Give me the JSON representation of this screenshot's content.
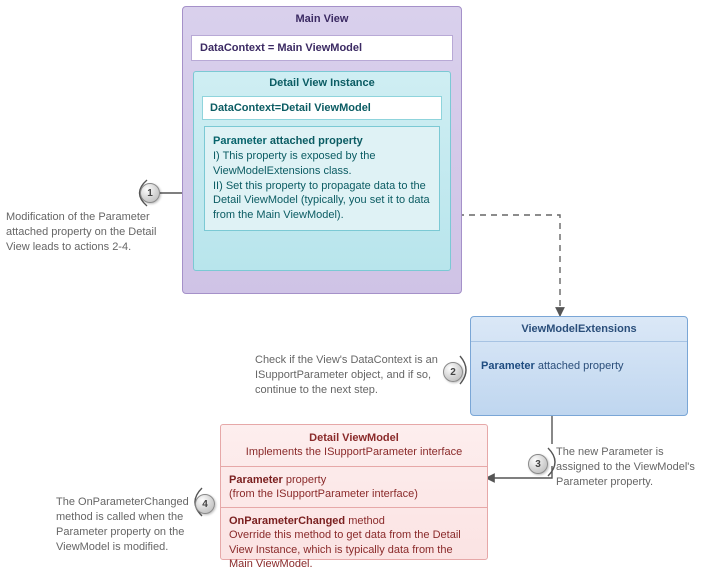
{
  "mainView": {
    "title": "Main View",
    "dataContext": "DataContext = Main ViewModel"
  },
  "detailView": {
    "title": "Detail View Instance",
    "dataContext": "DataContext=Detail ViewModel",
    "paramHeadingBold": "Parameter",
    "paramHeadingRest": " attached property",
    "line1": "I)  This property is exposed by the ViewModelExtensions class.",
    "line2": "II) Set this property to propagate data to the Detail ViewModel (typically, you set it to data from the Main ViewModel)."
  },
  "vmext": {
    "title": "ViewModelExtensions",
    "paramBold": "Parameter",
    "paramRest": " attached property"
  },
  "dvm": {
    "title": "Detail ViewModel",
    "subtitle": "Implements the ISupportParameter interface",
    "sec1Bold": "Parameter",
    "sec1Rest": " property",
    "sec1Note": "(from the ISupportParameter interface)",
    "sec2Bold": "OnParameterChanged",
    "sec2Rest": " method",
    "sec2Note": "Override this method to get data from the Detail View Instance, which is typically data from the Main ViewModel."
  },
  "badges": {
    "s1": "1",
    "s2": "2",
    "s3": "3",
    "s4": "4"
  },
  "notes": {
    "n1": "Modification of the Parameter attached property on the Detail View leads to actions 2-4.",
    "n2": "Check if the View's DataContext is an ISupportParameter object, and if so, continue to the next step.",
    "n3": "The new Parameter is assigned to the ViewModel's Parameter property.",
    "n4": "The OnParameterChanged method is called when the Parameter property on the ViewModel is modified."
  }
}
